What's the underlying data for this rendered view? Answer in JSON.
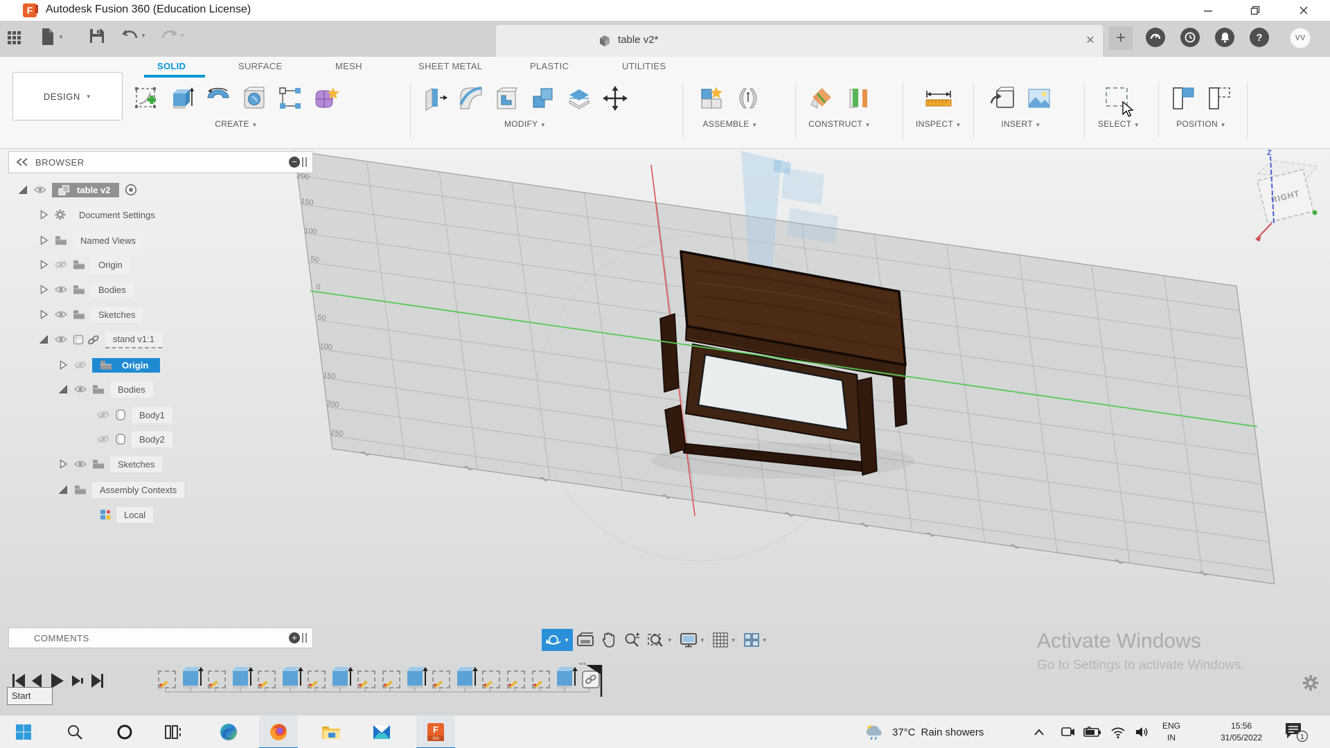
{
  "titlebar": {
    "title": "Autodesk Fusion 360 (Education License)"
  },
  "tabs": {
    "document": "table v2*",
    "avatar_initials": "VV",
    "close_glyph": "✕",
    "new_tab_glyph": "+"
  },
  "ribbon": {
    "design": "DESIGN",
    "tabs": [
      "SOLID",
      "SURFACE",
      "MESH",
      "SHEET METAL",
      "PLASTIC",
      "UTILITIES"
    ],
    "groups": [
      "CREATE",
      "MODIFY",
      "ASSEMBLE",
      "CONSTRUCT",
      "INSPECT",
      "INSERT",
      "SELECT",
      "POSITION"
    ]
  },
  "browser": {
    "header": "BROWSER",
    "comments_header": "COMMENTS",
    "tree": [
      {
        "label": "table v2",
        "level": 0,
        "state": "expanded",
        "eye": "on",
        "icon": "component",
        "selected": "gray"
      },
      {
        "label": "Document Settings",
        "level": 1,
        "state": "collapsed",
        "eye": "none",
        "icon": "gear"
      },
      {
        "label": "Named Views",
        "level": 1,
        "state": "collapsed",
        "eye": "none",
        "icon": "folder"
      },
      {
        "label": "Origin",
        "level": 1,
        "state": "collapsed",
        "eye": "off",
        "icon": "folder"
      },
      {
        "label": "Bodies",
        "level": 1,
        "state": "collapsed",
        "eye": "on",
        "icon": "folder"
      },
      {
        "label": "Sketches",
        "level": 1,
        "state": "collapsed",
        "eye": "on",
        "icon": "folder"
      },
      {
        "label": "stand v1:1",
        "level": 1,
        "state": "expanded",
        "eye": "on",
        "icon": "component-link"
      },
      {
        "label": "Origin",
        "level": 2,
        "state": "collapsed",
        "eye": "off",
        "icon": "folder",
        "selected": "blue"
      },
      {
        "label": "Bodies",
        "level": 2,
        "state": "expanded",
        "eye": "on",
        "icon": "folder"
      },
      {
        "label": "Body1",
        "level": 3,
        "state": "leaf",
        "eye": "off",
        "icon": "body"
      },
      {
        "label": "Body2",
        "level": 3,
        "state": "leaf",
        "eye": "off",
        "icon": "body"
      },
      {
        "label": "Sketches",
        "level": 2,
        "state": "collapsed",
        "eye": "on",
        "icon": "folder"
      },
      {
        "label": "Assembly Contexts",
        "level": 2,
        "state": "expanded",
        "eye": "none",
        "icon": "folder"
      },
      {
        "label": "Local",
        "level": 3,
        "state": "leaf",
        "eye": "none",
        "icon": "context"
      }
    ]
  },
  "viewport": {
    "viewcube_face": "RIGHT",
    "axis_z": "Z",
    "ruler": [
      "200",
      "150",
      "100",
      "50",
      "0",
      "50",
      "100",
      "150",
      "200",
      "250"
    ],
    "watermark_title": "Activate Windows",
    "watermark_sub": "Go to Settings to activate Windows."
  },
  "timeline": {
    "start_tooltip": "Start"
  },
  "taskbar": {
    "temperature": "37°C",
    "weather": "Rain showers",
    "lang_top": "ENG",
    "lang_bottom": "IN",
    "time": "15:56",
    "date": "31/05/2022",
    "badge": "1"
  },
  "colors": {
    "accent_blue": "#0696d7",
    "taskbar_accent": "#0078d7",
    "select_green": "#8aa58a",
    "wood": "#4b2a16"
  },
  "icons": {
    "dropdown_caret": "▼",
    "collapse_panel": "««",
    "minimize_panel": "−",
    "add_comment": "+"
  }
}
